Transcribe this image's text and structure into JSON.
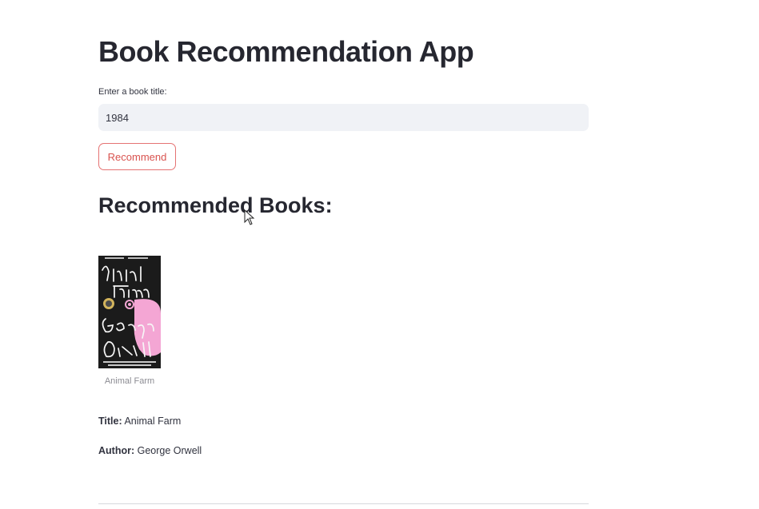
{
  "app": {
    "title": "Book Recommendation App"
  },
  "search": {
    "label": "Enter a book title:",
    "value": "1984"
  },
  "actions": {
    "recommend_label": "Recommend"
  },
  "results": {
    "heading": "Recommended Books:",
    "books": [
      {
        "cover_image": "book-cover-image",
        "caption": "Animal Farm",
        "title_key": "Title:",
        "title": "Animal Farm",
        "author_key": "Author:",
        "author": "George Orwell"
      }
    ]
  },
  "colors": {
    "input_background": "#f0f2f6",
    "button_border": "#e57373",
    "button_text": "#d9534f",
    "cover_background": "#1b1b1b",
    "cover_accent": "#f4a6d4"
  }
}
